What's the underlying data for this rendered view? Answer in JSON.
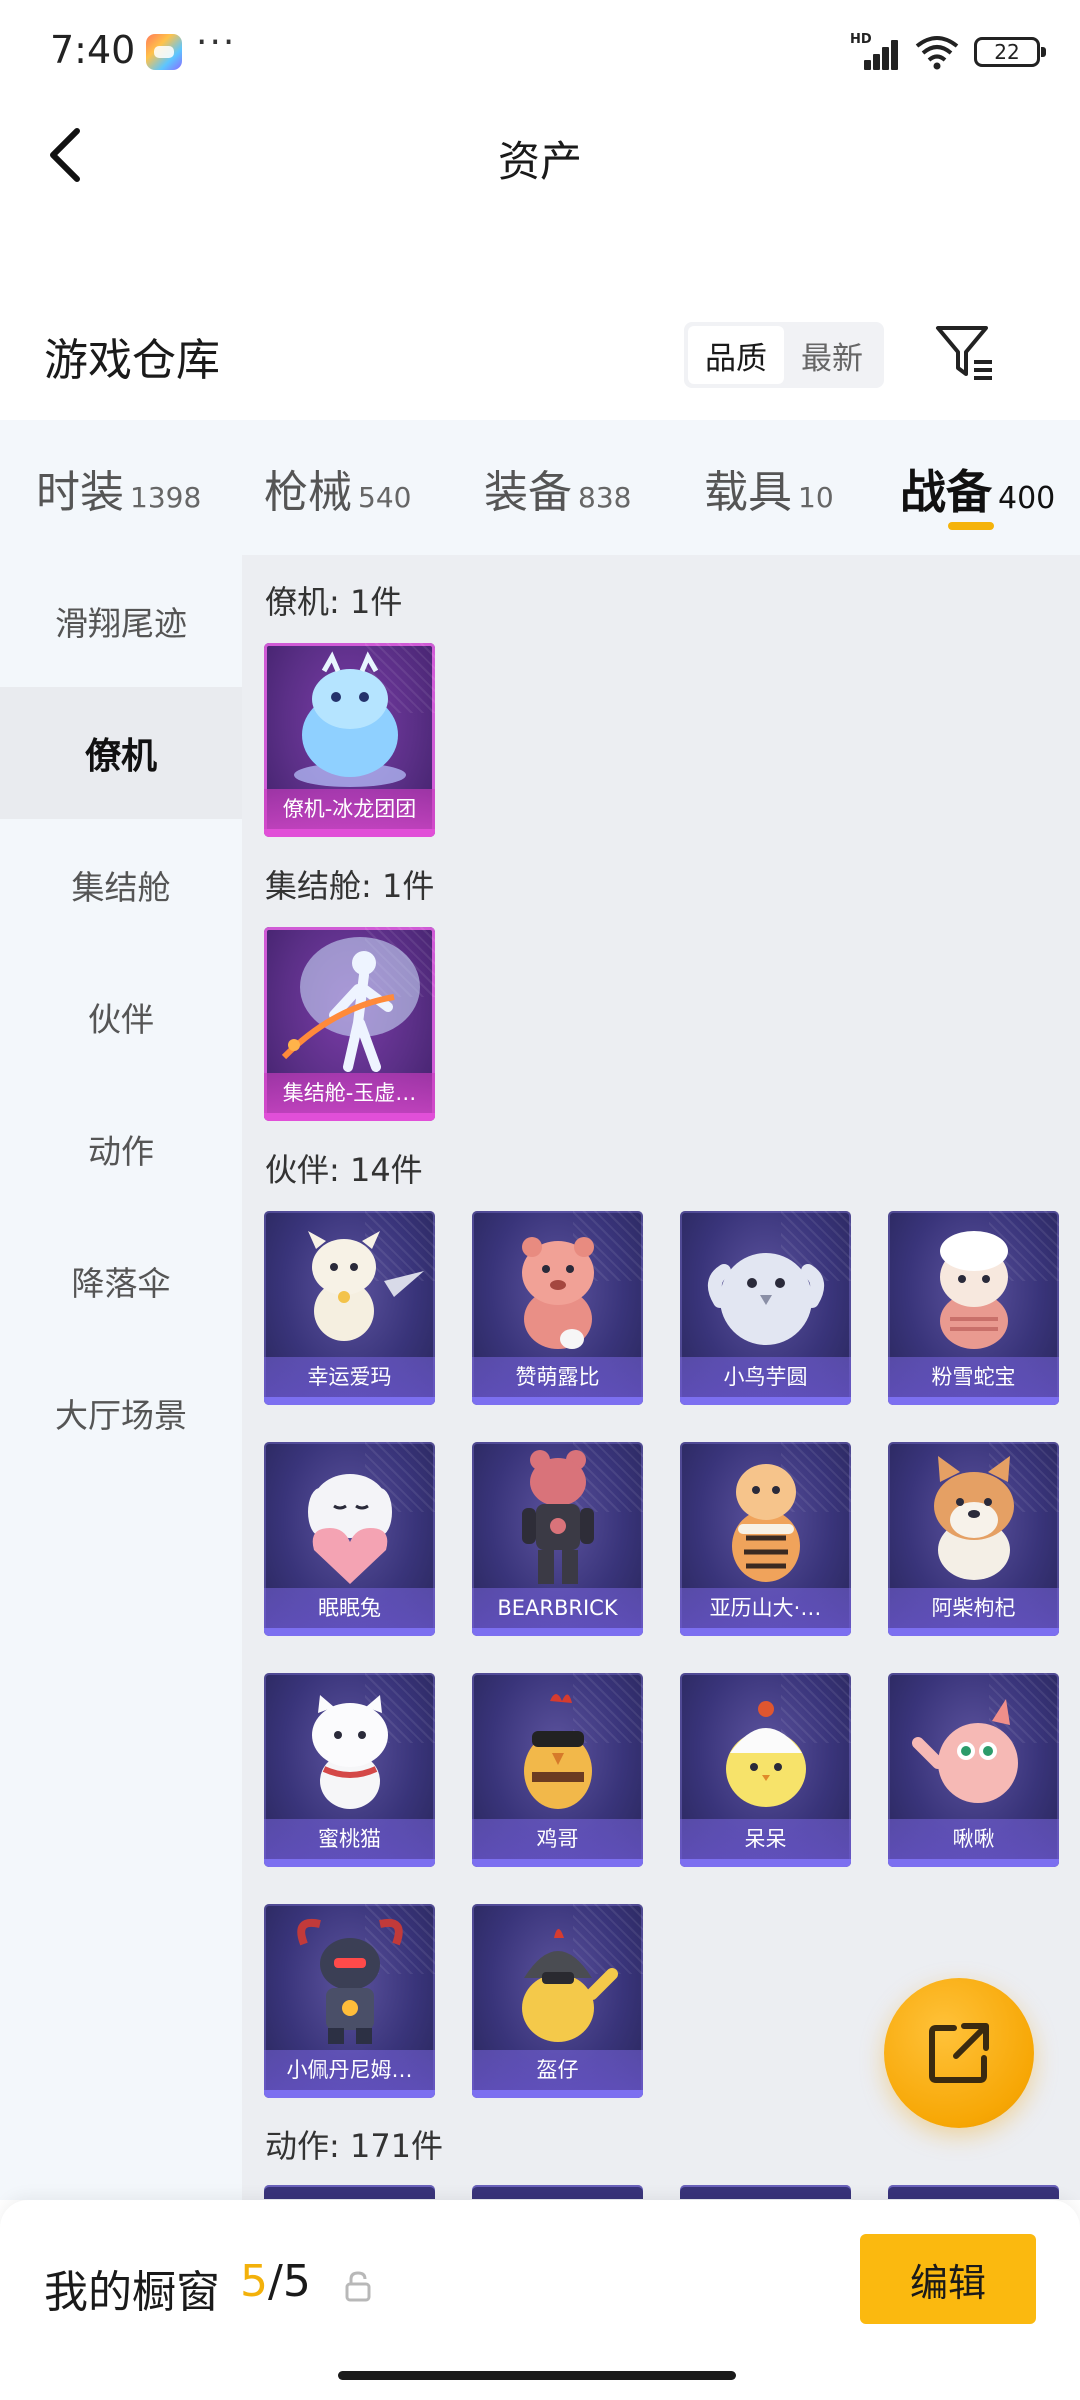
{
  "status_bar": {
    "time": "7:40",
    "more": "···",
    "signal_badge": "HD",
    "battery": "22"
  },
  "header": {
    "title": "资产"
  },
  "section": {
    "title": "游戏仓库",
    "sort_options": [
      "品质",
      "最新"
    ],
    "sort_selected": "品质"
  },
  "tabs": [
    {
      "label": "时装",
      "count": "1398"
    },
    {
      "label": "枪械",
      "count": "540"
    },
    {
      "label": "装备",
      "count": "838"
    },
    {
      "label": "载具",
      "count": "10"
    },
    {
      "label": "战备",
      "count": "400",
      "active": true
    }
  ],
  "sidebar": {
    "items": [
      "滑翔尾迹",
      "僚机",
      "集结舱",
      "伙伴",
      "动作",
      "降落伞",
      "大厅场景"
    ],
    "active": "僚机"
  },
  "groups": [
    {
      "title": "僚机: 1件",
      "items": [
        {
          "name": "僚机-冰龙团团",
          "rarity": "epic"
        }
      ]
    },
    {
      "title": "集结舱: 1件",
      "items": [
        {
          "name": "集结舱-玉虚…",
          "rarity": "epic"
        }
      ]
    },
    {
      "title": "伙伴: 14件",
      "items": [
        {
          "name": "幸运爱玛"
        },
        {
          "name": "赞萌露比"
        },
        {
          "name": "小鸟芋圆"
        },
        {
          "name": "粉雪蛇宝"
        },
        {
          "name": "眠眠兔"
        },
        {
          "name": "BEARBRICK"
        },
        {
          "name": "亚历山大·…"
        },
        {
          "name": "阿柴枸杞"
        },
        {
          "name": "蜜桃猫"
        },
        {
          "name": "鸡哥"
        },
        {
          "name": "呆呆"
        },
        {
          "name": "啾啾"
        },
        {
          "name": "小佩丹尼姆…"
        },
        {
          "name": "盔仔"
        }
      ]
    },
    {
      "title": "动作: 171件",
      "items": []
    }
  ],
  "bottom_bar": {
    "label": "我的橱窗",
    "current": "5",
    "total": "/5",
    "edit_label": "编辑"
  },
  "colors": {
    "accent": "#f5b30a",
    "epic_border": "#d05bd6",
    "card_bg": "#39347a"
  }
}
